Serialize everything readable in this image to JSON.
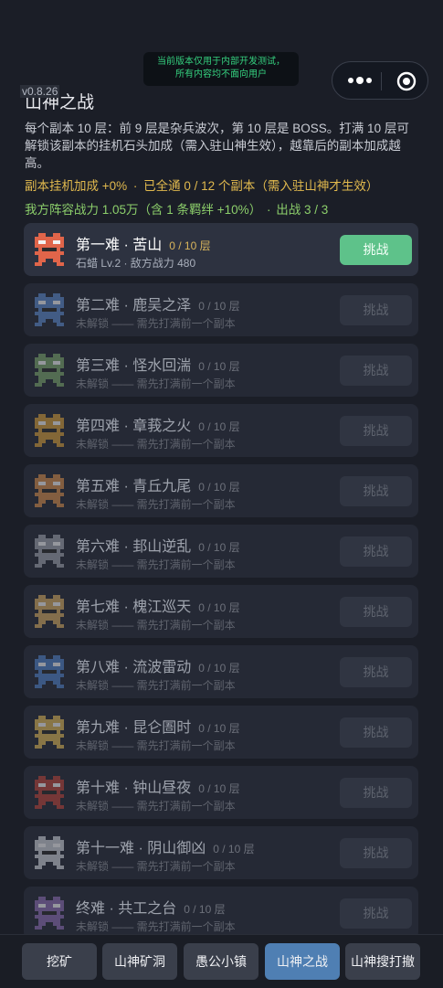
{
  "notice": {
    "line1": "当前版本仅用于内部开发测试，",
    "line2": "所有内容均不面向用户"
  },
  "version": "v0.8.26",
  "title": "山神之战",
  "description": "每个副本 10 层：前 9 层是杂兵波次，第 10 层是 BOSS。打满 10 层可解锁该副本的挂机石头加成（需入驻山神生效），越靠后的副本加成越高。",
  "stats": {
    "idle_bonus": "副本挂机加成 +0%",
    "cleared": "已全通 0 / 12 个副本（需入驻山神才生效）",
    "power": "我方阵容战力 1.05万（含 1 条羁绊 +10%）",
    "deploy": "出战 3 / 3",
    "separator": "·"
  },
  "colors": {
    "accent_green": "#5ec28a",
    "gold": "#e1b94e",
    "power_green": "#8ccf6b",
    "tab_selected": "#4f7fb3"
  },
  "dungeons": [
    {
      "name": "第一难 · 苦山",
      "floors": "0 / 10 层",
      "sub": "石蜡 Lv.2 · 敌方战力 480",
      "button": "挑战",
      "locked": false,
      "avatar": {
        "icon": "red-demon",
        "color": "#e0654a"
      }
    },
    {
      "name": "第二难 · 鹿吴之泽",
      "floors": "0 / 10 层",
      "sub": "未解锁 —— 需先打满前一个副本",
      "button": "挑战",
      "locked": true,
      "avatar": {
        "icon": "blue-beast",
        "color": "#5b86c8"
      }
    },
    {
      "name": "第三难 · 怪水回湍",
      "floors": "0 / 10 层",
      "sub": "未解锁 —— 需先打满前一个副本",
      "button": "挑战",
      "locked": true,
      "avatar": {
        "icon": "green-turtle",
        "color": "#7aa36a"
      }
    },
    {
      "name": "第四难 · 章莪之火",
      "floors": "0 / 10 层",
      "sub": "未解锁 —— 需先打满前一个副本",
      "button": "挑战",
      "locked": true,
      "avatar": {
        "icon": "fire-beast",
        "color": "#d19a3a"
      }
    },
    {
      "name": "第五难 · 青丘九尾",
      "floors": "0 / 10 层",
      "sub": "未解锁 —— 需先打满前一个副本",
      "button": "挑战",
      "locked": true,
      "avatar": {
        "icon": "fox",
        "color": "#d08a4a"
      }
    },
    {
      "name": "第六难 · 邽山逆乱",
      "floors": "0 / 10 层",
      "sub": "未解锁 —— 需先打满前一个副本",
      "button": "挑战",
      "locked": true,
      "avatar": {
        "icon": "stone-golem",
        "color": "#9a9ea8"
      }
    },
    {
      "name": "第七难 · 槐江巡天",
      "floors": "0 / 10 层",
      "sub": "未解锁 —— 需先打满前一个副本",
      "button": "挑战",
      "locked": true,
      "avatar": {
        "icon": "sky-beast",
        "color": "#d0a860"
      }
    },
    {
      "name": "第八难 · 流波雷动",
      "floors": "0 / 10 层",
      "sub": "未解锁 —— 需先打满前一个副本",
      "button": "挑战",
      "locked": true,
      "avatar": {
        "icon": "thunder-beast",
        "color": "#4f7fc4"
      }
    },
    {
      "name": "第九难 · 昆仑圄时",
      "floors": "0 / 10 层",
      "sub": "未解锁 —— 需先打满前一个副本",
      "button": "挑战",
      "locked": true,
      "avatar": {
        "icon": "horned-deer",
        "color": "#d9b455"
      }
    },
    {
      "name": "第十难 · 钟山昼夜",
      "floors": "0 / 10 层",
      "sub": "未解锁 —— 需先打满前一个副本",
      "button": "挑战",
      "locked": true,
      "avatar": {
        "icon": "dragon",
        "color": "#b8443a"
      }
    },
    {
      "name": "第十一难 · 阴山御凶",
      "floors": "0 / 10 层",
      "sub": "未解锁 —— 需先打满前一个副本",
      "button": "挑战",
      "locked": true,
      "avatar": {
        "icon": "ghost-beast",
        "color": "#c8cbd2"
      }
    },
    {
      "name": "终难 · 共工之台",
      "floors": "0 / 10 层",
      "sub": "未解锁 —— 需先打满前一个副本",
      "button": "挑战",
      "locked": true,
      "avatar": {
        "icon": "gonggong",
        "color": "#8a6bb0"
      }
    }
  ],
  "tabs": [
    {
      "label": "挖矿",
      "selected": false
    },
    {
      "label": "山神矿洞",
      "selected": false
    },
    {
      "label": "愚公小镇",
      "selected": false
    },
    {
      "label": "山神之战",
      "selected": true
    },
    {
      "label": "山神搜打撤",
      "selected": false
    }
  ]
}
